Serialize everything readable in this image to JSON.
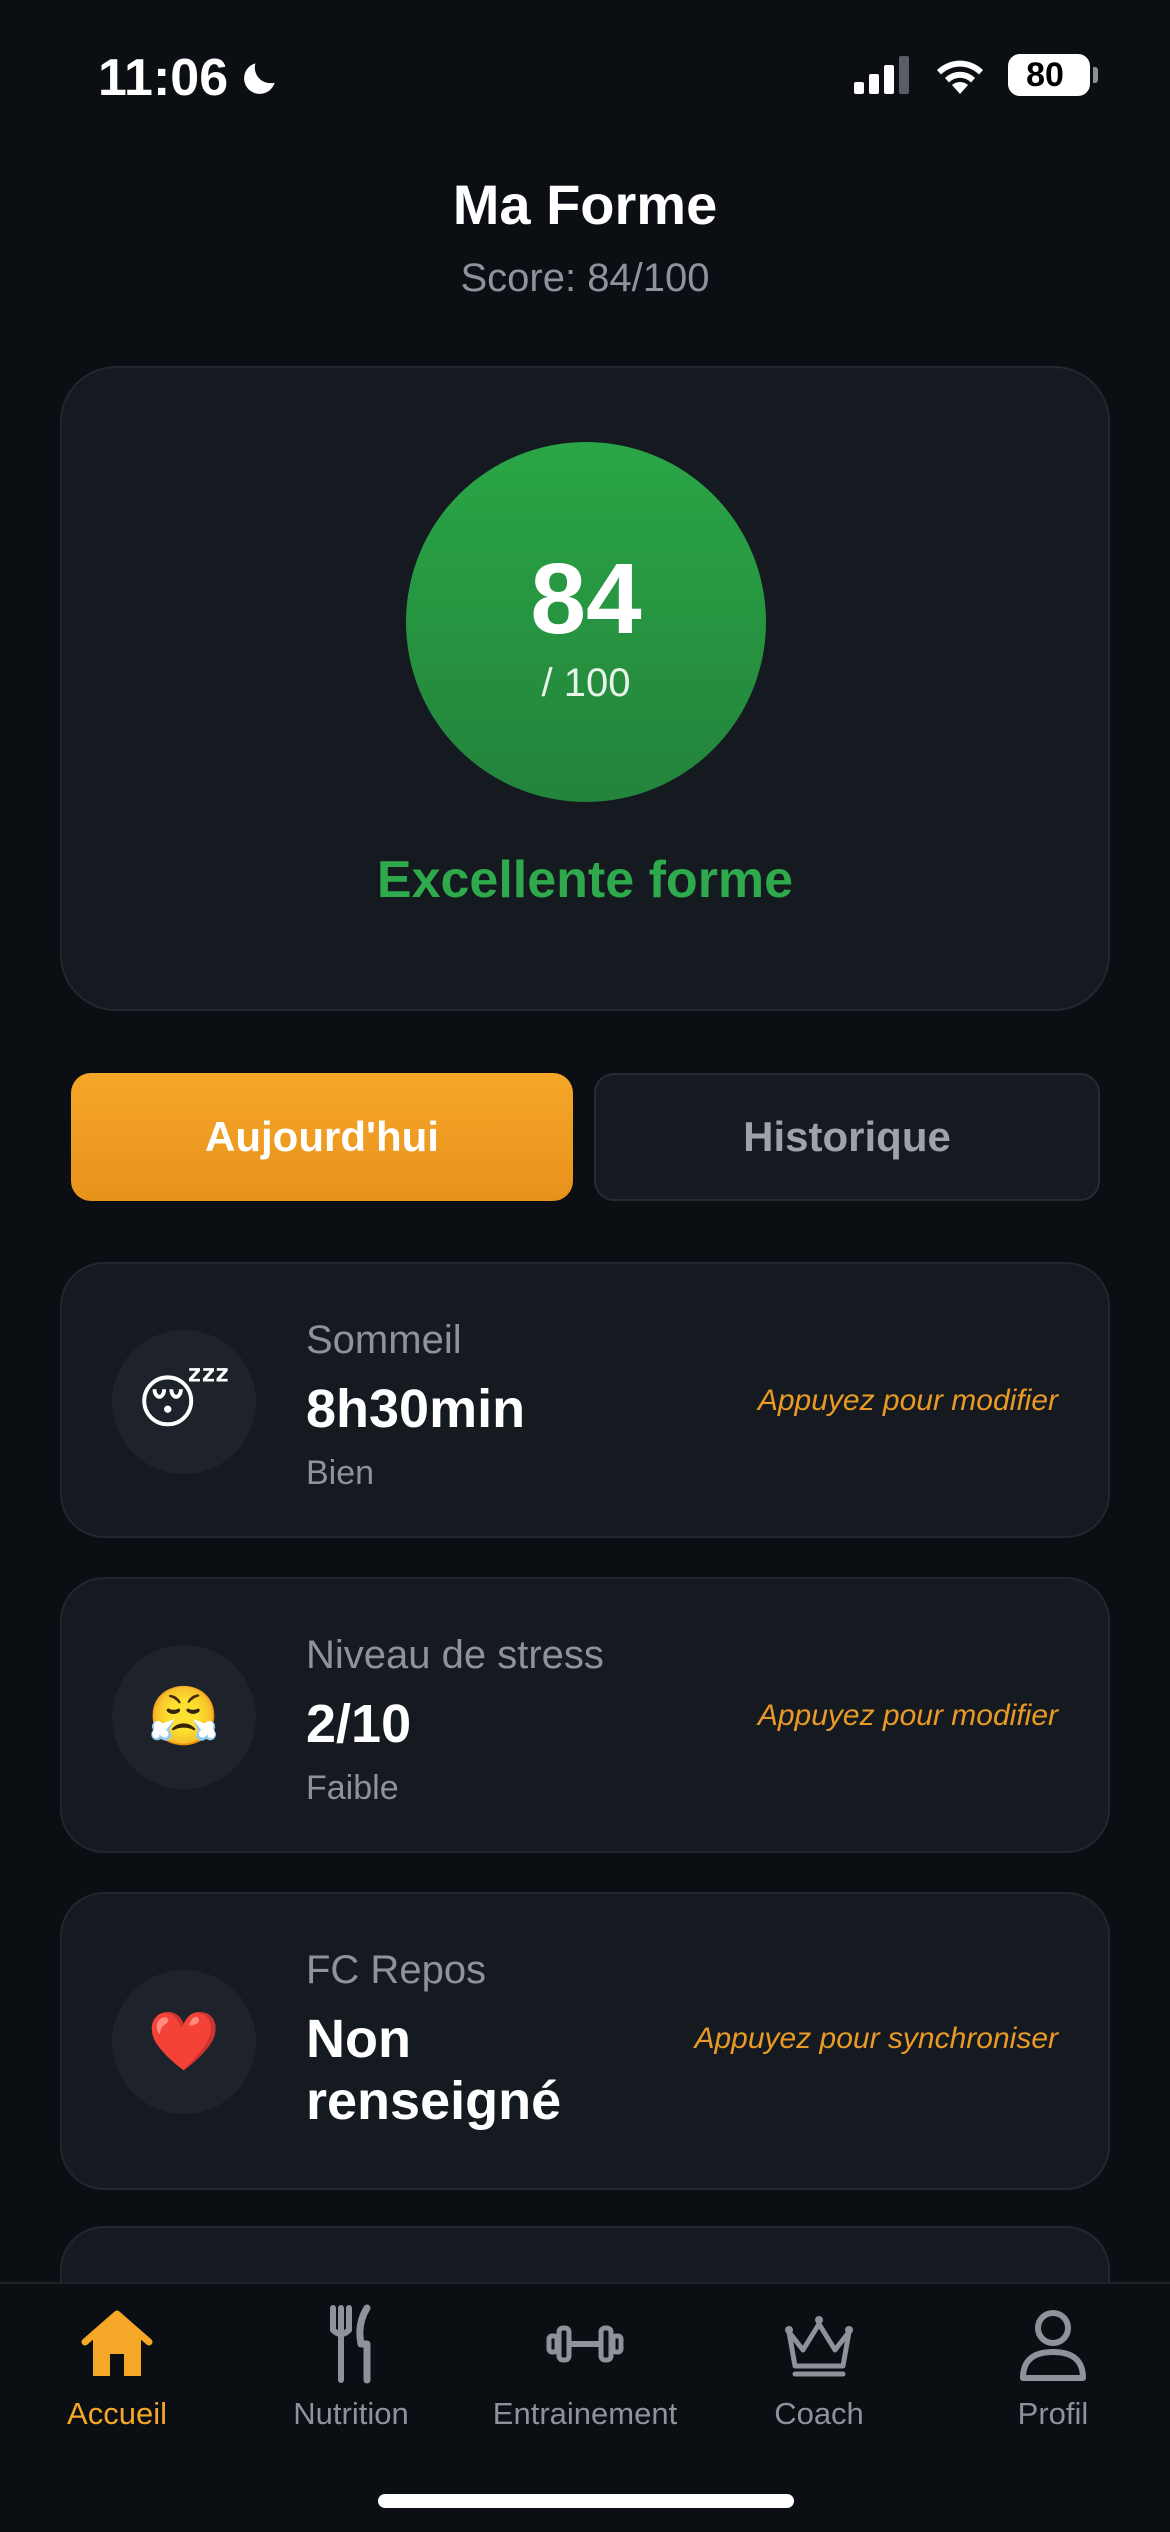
{
  "status_bar": {
    "time": "11:06",
    "battery": "80"
  },
  "header": {
    "title": "Ma Forme",
    "subtitle": "Score: 84/100"
  },
  "score_card": {
    "score": "84",
    "max": "/ 100",
    "label": "Excellente forme",
    "accent": "#2ea94b"
  },
  "tabs": {
    "today": "Aujourd'hui",
    "history": "Historique"
  },
  "metrics": [
    {
      "icon": "😴",
      "label": "Sommeil",
      "value": "8h30min",
      "status": "Bien",
      "action": "Appuyez pour modifier"
    },
    {
      "icon": "😤",
      "label": "Niveau de stress",
      "value": "2/10",
      "status": "Faible",
      "action": "Appuyez pour modifier"
    },
    {
      "icon": "❤️",
      "label": "FC Repos",
      "value_line1": "Non",
      "value_line2": "renseigné",
      "action": "Appuyez pour synchroniser"
    }
  ],
  "nav": {
    "home": "Accueil",
    "nutrition": "Nutrition",
    "training": "Entrainement",
    "coach": "Coach",
    "profile": "Profil",
    "active_color": "#f5a728"
  }
}
